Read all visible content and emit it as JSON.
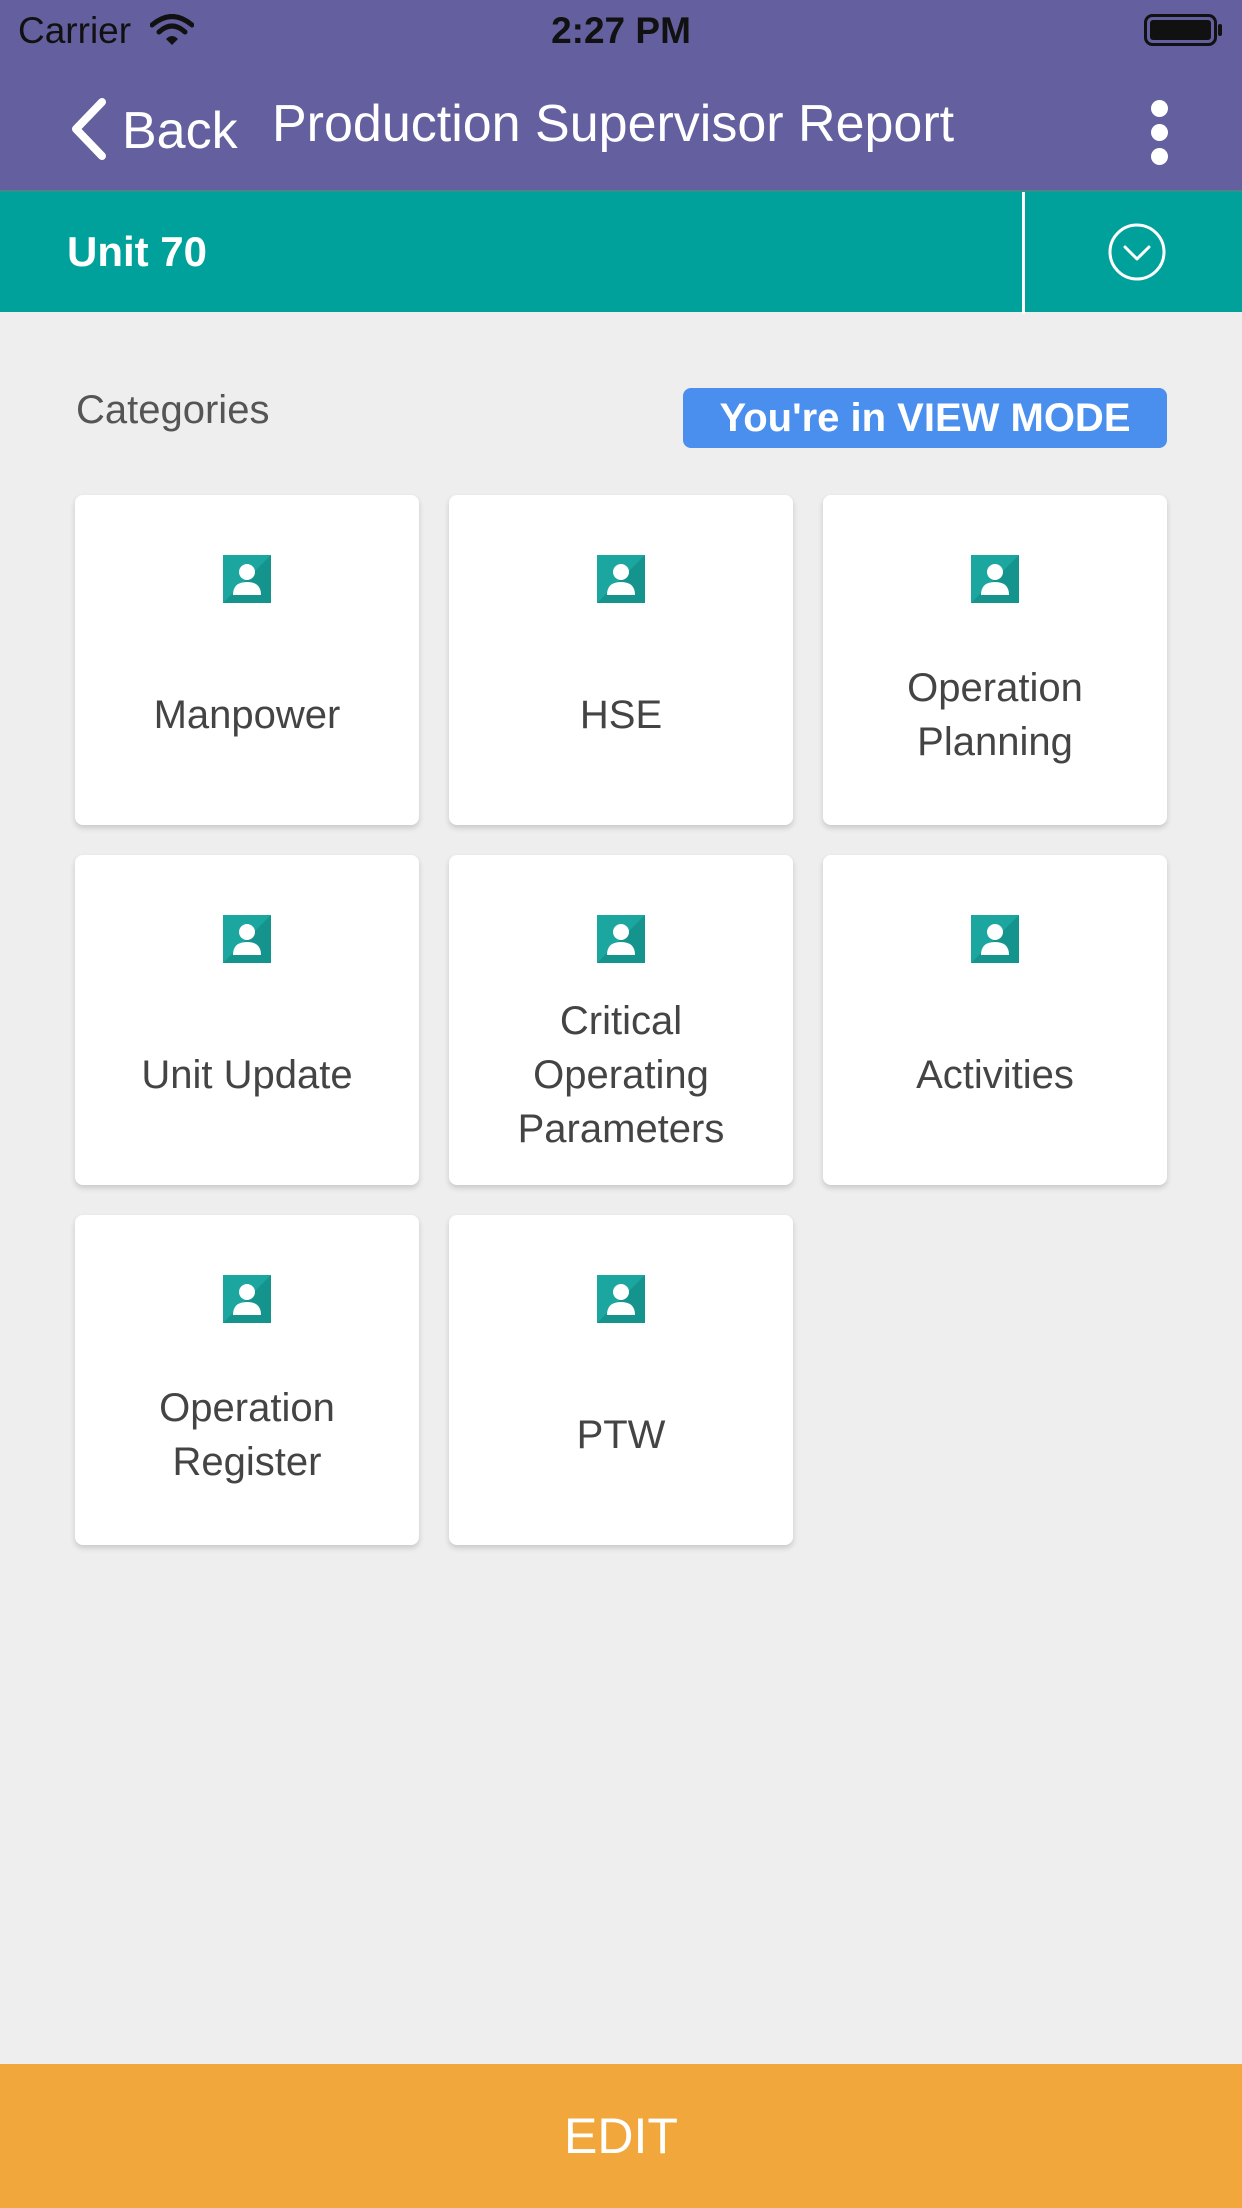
{
  "status_bar": {
    "carrier": "Carrier",
    "time": "2:27 PM"
  },
  "nav": {
    "back_label": "Back",
    "title": "Production Supervisor Report"
  },
  "unit": {
    "name": "Unit 70"
  },
  "content": {
    "categories_label": "Categories",
    "view_mode_badge": "You're in VIEW MODE"
  },
  "tiles": [
    {
      "label": "Manpower",
      "icon": "person-icon"
    },
    {
      "label": "HSE",
      "icon": "person-icon"
    },
    {
      "label": "Operation Planning",
      "icon": "person-icon"
    },
    {
      "label": "Unit Update",
      "icon": "person-icon"
    },
    {
      "label": "Critical Operating Parameters",
      "icon": "person-icon"
    },
    {
      "label": "Activities",
      "icon": "person-icon"
    },
    {
      "label": "Operation Register",
      "icon": "person-icon"
    },
    {
      "label": "PTW",
      "icon": "person-icon"
    }
  ],
  "footer": {
    "edit_label": "EDIT"
  },
  "colors": {
    "nav_bg": "#645f9e",
    "unit_bar_bg": "#00a19a",
    "badge_bg": "#4a8eee",
    "edit_bg": "#f2a73d",
    "icon_teal": "#1ba6a0"
  }
}
